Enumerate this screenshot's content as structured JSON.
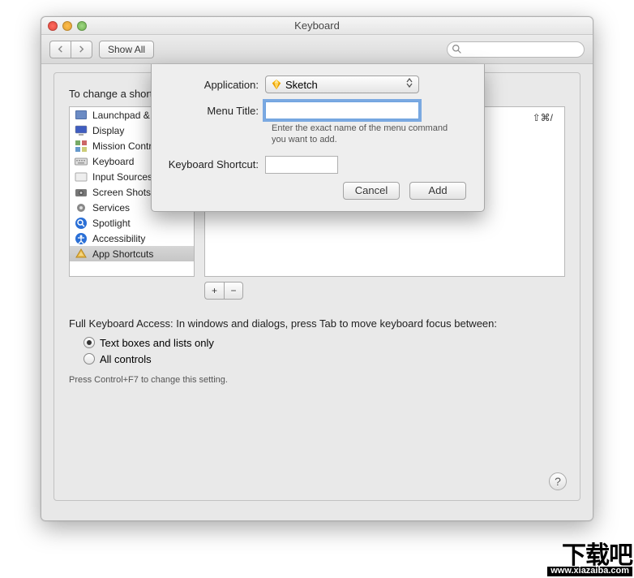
{
  "window": {
    "title": "Keyboard"
  },
  "toolbar": {
    "back": "◀",
    "forward": "▶",
    "show_all": "Show All",
    "search_placeholder": ""
  },
  "panel": {
    "instruction": "To change a shortcut, select it, click the key combination, and then type the new keys.",
    "existing_shortcut": "⇧⌘/",
    "categories": [
      {
        "label": "Launchpad & Dock",
        "icon": "rocket",
        "selected": false
      },
      {
        "label": "Display",
        "icon": "display",
        "selected": false
      },
      {
        "label": "Mission Control",
        "icon": "mission",
        "selected": false
      },
      {
        "label": "Keyboard",
        "icon": "keyboard",
        "selected": false
      },
      {
        "label": "Input Sources",
        "icon": "input",
        "selected": false
      },
      {
        "label": "Screen Shots",
        "icon": "camera",
        "selected": false
      },
      {
        "label": "Services",
        "icon": "gear",
        "selected": false
      },
      {
        "label": "Spotlight",
        "icon": "spotlight",
        "selected": false
      },
      {
        "label": "Accessibility",
        "icon": "access",
        "selected": false
      },
      {
        "label": "App Shortcuts",
        "icon": "app",
        "selected": true
      }
    ],
    "add": "+",
    "remove": "−",
    "fk_text": "Full Keyboard Access: In windows and dialogs, press Tab to move keyboard focus between:",
    "radio1": "Text boxes and lists only",
    "radio2": "All controls",
    "hint": "Press Control+F7 to change this setting.",
    "help": "?"
  },
  "sheet": {
    "app_label": "Application:",
    "app_value": "Sketch",
    "menu_label": "Menu Title:",
    "menu_value": "",
    "menu_help": "Enter the exact name of the menu command you want to add.",
    "short_label": "Keyboard Shortcut:",
    "short_value": "",
    "cancel": "Cancel",
    "add": "Add"
  },
  "watermark": {
    "text": "下载吧",
    "url": "www.xiazaiba.com"
  }
}
